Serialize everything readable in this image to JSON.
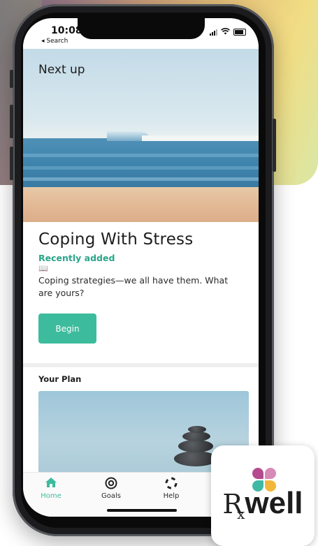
{
  "status_bar": {
    "time": "10:08",
    "back_label": "◂ Search"
  },
  "hero": {
    "heading": "Next up"
  },
  "lesson": {
    "title": "Coping With Stress",
    "tag": "Recently added",
    "tag_color": "#2aa58a",
    "book_icon": "📖",
    "description": "Coping strategies—we all have them. What are yours?",
    "button_label": "Begin",
    "button_color": "#3dbb9d"
  },
  "plan": {
    "title": "Your Plan"
  },
  "tab_bar": {
    "items": [
      {
        "label": "Home",
        "icon": "home-icon",
        "active": true
      },
      {
        "label": "Goals",
        "icon": "target-icon",
        "active": false
      },
      {
        "label": "Help",
        "icon": "lifebuoy-icon",
        "active": false
      }
    ]
  },
  "logo": {
    "r": "R",
    "x": "x",
    "well": "well",
    "petal_colors": [
      "#b54a8f",
      "#d789b8",
      "#3fb9a4",
      "#f2b63a"
    ]
  }
}
